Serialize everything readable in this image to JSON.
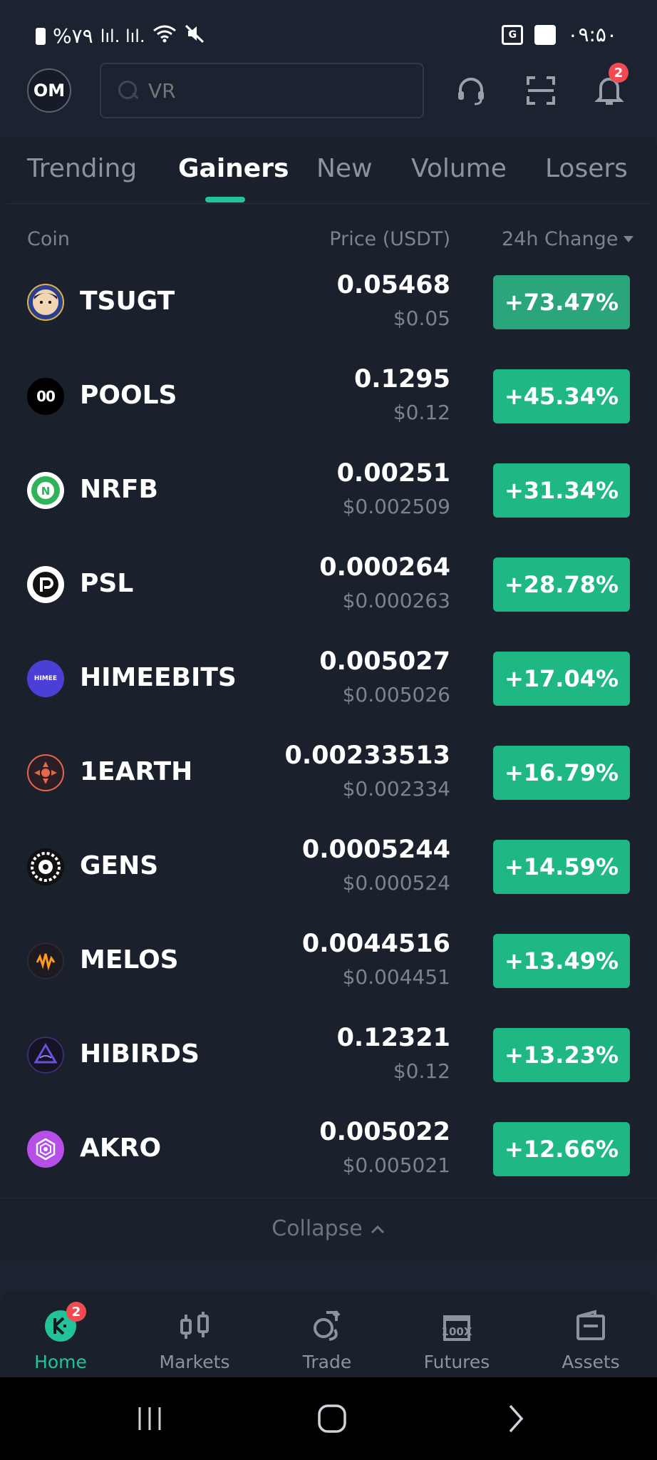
{
  "status_bar": {
    "battery": "%۷۹",
    "time": "۰۹:۵۰"
  },
  "header": {
    "avatar_initials": "OM",
    "search_placeholder": "VR",
    "notification_count": "2"
  },
  "tabs": [
    "Trending",
    "Gainers",
    "New",
    "Volume",
    "Losers"
  ],
  "active_tab": "Gainers",
  "columns": {
    "coin": "Coin",
    "price": "Price (USDT)",
    "change": "24h Change"
  },
  "coins": [
    {
      "name": "TSUGT",
      "price": "0.05468",
      "price_usd": "$0.05",
      "change": "+73.47%",
      "icon": "tsugt-coin-icon",
      "color": "#2b3f8f"
    },
    {
      "name": "POOLS",
      "price": "0.1295",
      "price_usd": "$0.12",
      "change": "+45.34%",
      "icon": "pools-coin-icon",
      "color": "#000000"
    },
    {
      "name": "NRFB",
      "price": "0.00251",
      "price_usd": "$0.002509",
      "change": "+31.34%",
      "icon": "nrfb-coin-icon",
      "color": "#ffffff"
    },
    {
      "name": "PSL",
      "price": "0.000264",
      "price_usd": "$0.000263",
      "change": "+28.78%",
      "icon": "psl-coin-icon",
      "color": "#ffffff"
    },
    {
      "name": "HIMEEBITS",
      "price": "0.005027",
      "price_usd": "$0.005026",
      "change": "+17.04%",
      "icon": "himeebits-coin-icon",
      "color": "#4b3fd6"
    },
    {
      "name": "1EARTH",
      "price": "0.00233513",
      "price_usd": "$0.002334",
      "change": "+16.79%",
      "icon": "1earth-coin-icon",
      "color": "#e8674a"
    },
    {
      "name": "GENS",
      "price": "0.0005244",
      "price_usd": "$0.000524",
      "change": "+14.59%",
      "icon": "gens-coin-icon",
      "color": "#ffffff"
    },
    {
      "name": "MELOS",
      "price": "0.0044516",
      "price_usd": "$0.004451",
      "change": "+13.49%",
      "icon": "melos-coin-icon",
      "color": "#ff9a1f"
    },
    {
      "name": "HIBIRDS",
      "price": "0.12321",
      "price_usd": "$0.12",
      "change": "+13.23%",
      "icon": "hibirds-coin-icon",
      "color": "#5a3fb8"
    },
    {
      "name": "AKRO",
      "price": "0.005022",
      "price_usd": "$0.005021",
      "change": "+12.66%",
      "icon": "akro-coin-icon",
      "color": "#b64ee8"
    }
  ],
  "collapse_label": "Collapse",
  "bottom_nav": [
    {
      "label": "Home",
      "badge": "2",
      "active": true
    },
    {
      "label": "Markets"
    },
    {
      "label": "Trade"
    },
    {
      "label": "Futures"
    },
    {
      "label": "Assets"
    }
  ],
  "colors": {
    "background": "#1c2330",
    "accent": "#21c397",
    "gain": "#1fb884",
    "badge": "#f04a53"
  }
}
